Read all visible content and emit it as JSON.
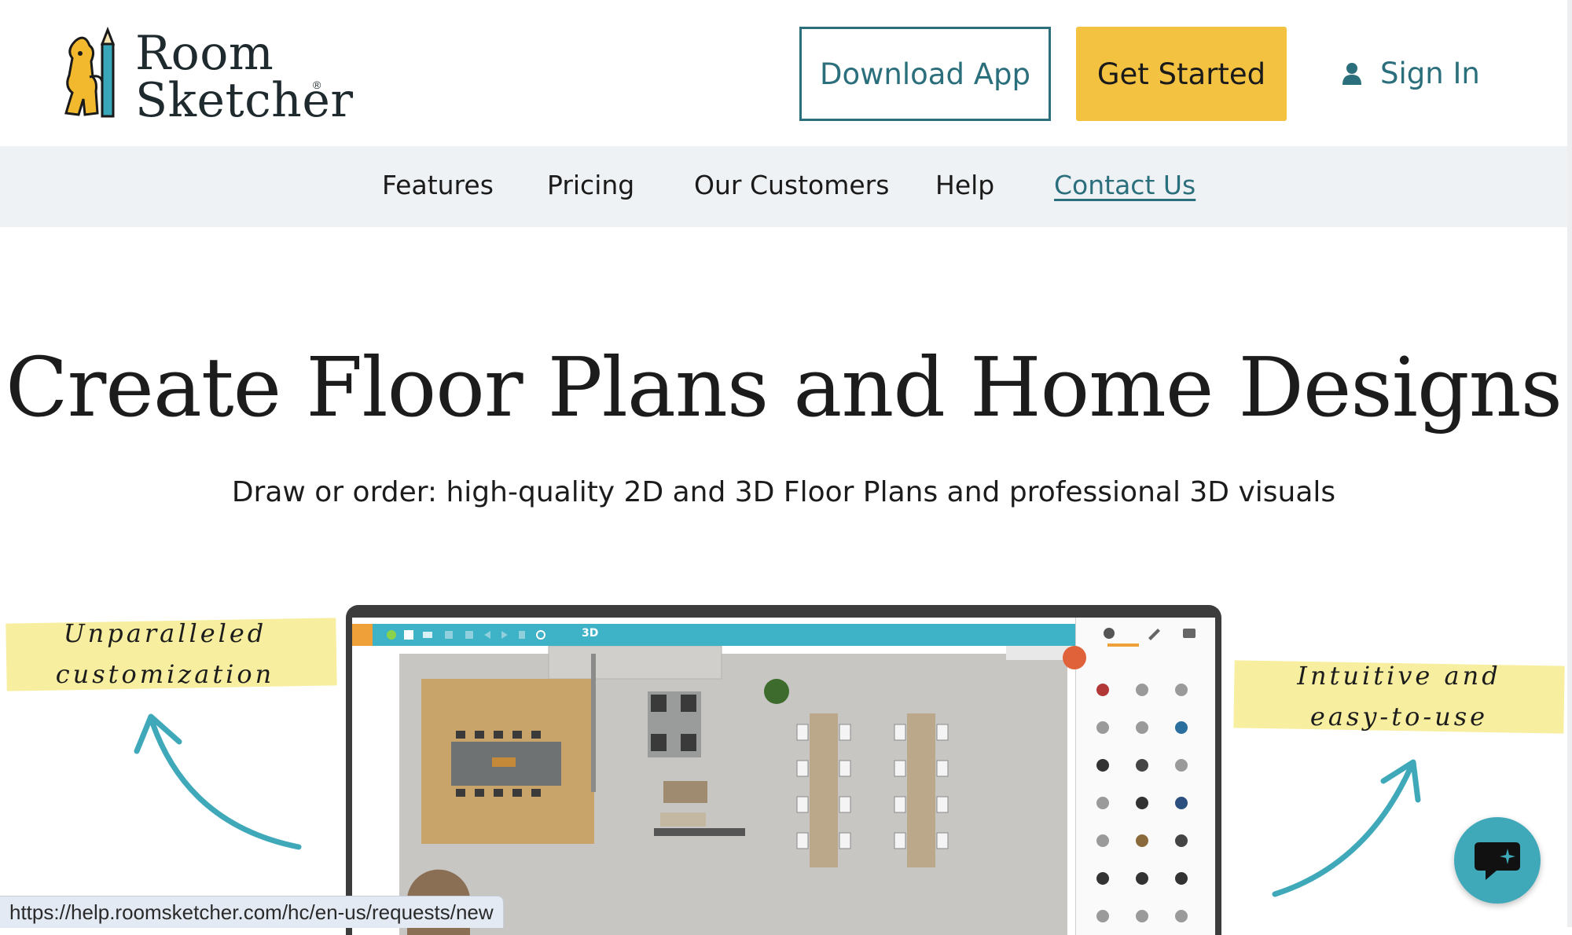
{
  "header": {
    "logo_line1": "Room",
    "logo_line2": "Sketcher",
    "logo_reg": "®",
    "download_label": "Download App",
    "get_started_label": "Get Started",
    "sign_in_label": "Sign In"
  },
  "nav": {
    "items": [
      {
        "label": "Features"
      },
      {
        "label": "Pricing"
      },
      {
        "label": "Our Customers"
      },
      {
        "label": "Help"
      },
      {
        "label": "Contact Us"
      }
    ]
  },
  "hero": {
    "title": "Create Floor Plans and Home Designs",
    "subtitle": "Draw or order: high-quality 2D and 3D Floor Plans and professional 3D visuals"
  },
  "callouts": {
    "left_line1": "Unparalleled",
    "left_line2": "customization",
    "right_line1": "Intuitive and",
    "right_line2": "easy-to-use"
  },
  "app_preview": {
    "toolbar_3d_label": "3D"
  },
  "status_bar": {
    "url": "https://help.roomsketcher.com/hc/en-us/requests/new"
  },
  "colors": {
    "brand_teal": "#2b6f7c",
    "cta_yellow": "#f3c241",
    "nav_bg": "#eef2f4",
    "chat_blue": "#3fa9ba"
  }
}
